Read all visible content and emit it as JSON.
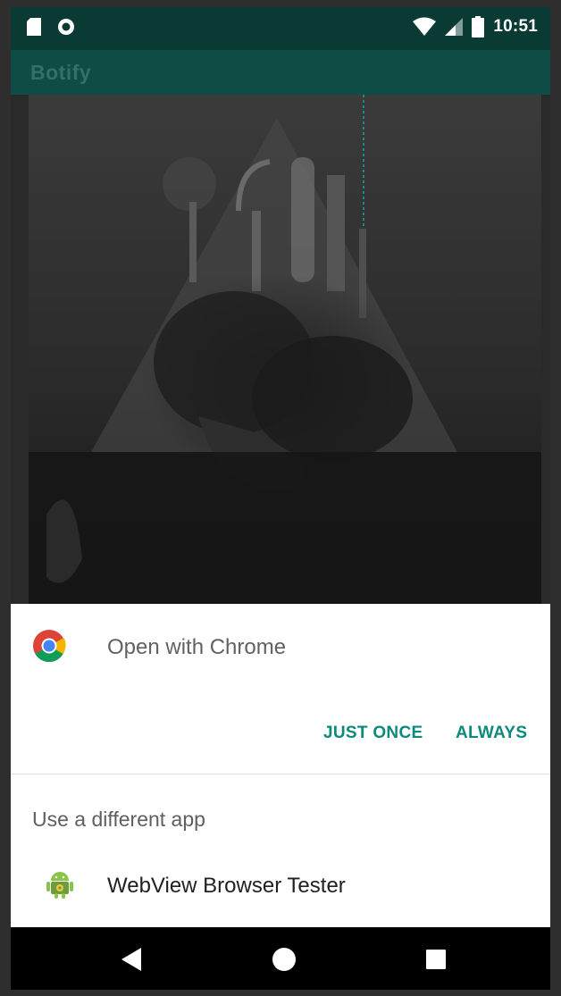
{
  "status_bar": {
    "time": "10:51",
    "icons": [
      "sd-card-icon",
      "circle-notification-icon",
      "wifi-icon",
      "signal-icon",
      "battery-icon"
    ]
  },
  "app_bar": {
    "title": "Botify"
  },
  "dialog": {
    "primary_app_label": "Open with Chrome",
    "primary_app_icon": "chrome-icon",
    "just_once_label": "JUST ONCE",
    "always_label": "ALWAYS",
    "different_app_label": "Use a different app",
    "apps": [
      {
        "label": "WebView Browser Tester",
        "icon": "android-icon"
      }
    ]
  },
  "nav_bar": {
    "icons": [
      "back-icon",
      "home-icon",
      "recents-icon"
    ]
  },
  "colors": {
    "status_bar": "#0a3a34",
    "app_bar": "#0e4c45",
    "accent": "#0e8a7a"
  }
}
